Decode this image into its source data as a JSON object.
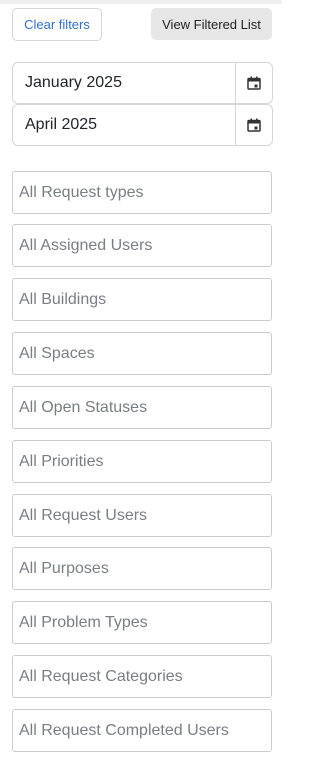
{
  "toolbar": {
    "clear_filters_label": "Clear filters",
    "view_filtered_list_label": "View Filtered List"
  },
  "date_range": {
    "start_value": "January 2025",
    "end_value": "April 2025",
    "icon": "calendar-icon"
  },
  "filters": [
    "All Request types",
    "All Assigned Users",
    "All Buildings",
    "All Spaces",
    "All Open Statuses",
    "All Priorities",
    "All Request Users",
    "All Purposes",
    "All Problem Types",
    "All Request Categories",
    "All Request Completed Users"
  ],
  "colors": {
    "link_blue": "#2f6fd6",
    "placeholder_gray": "#7a7e84",
    "border_gray": "#c9ccd1",
    "button_gray": "#e6e6e6"
  }
}
